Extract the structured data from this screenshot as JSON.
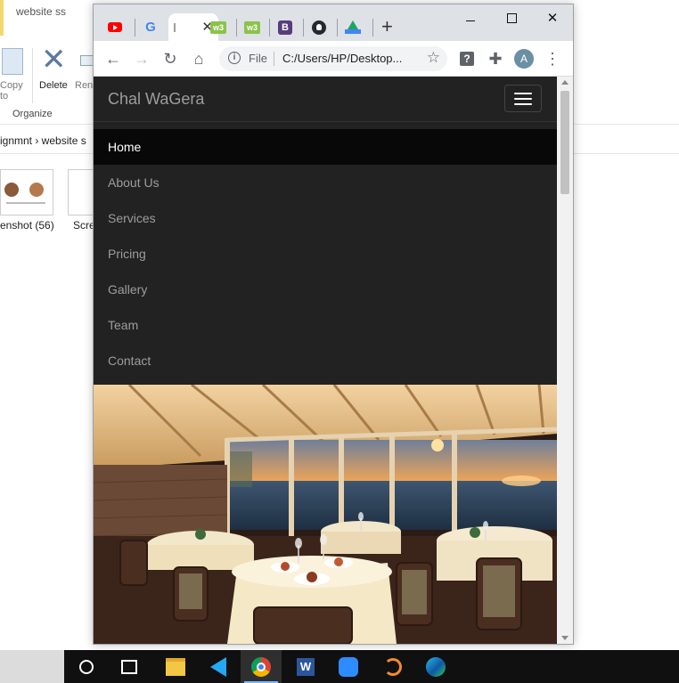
{
  "explorer": {
    "window_title": "website ss",
    "ribbon": {
      "copy_label": "Copy",
      "copy_label2": "to",
      "delete_label": "Delete",
      "rename_label": "Ren",
      "group_label": "Organize"
    },
    "breadcrumb": "ignmnt  ›  website s",
    "files": [
      {
        "label": "enshot (56)"
      },
      {
        "label": "Scre"
      }
    ]
  },
  "browser": {
    "tabs": [
      {
        "icon": "youtube-icon"
      },
      {
        "icon": "google-icon",
        "glyph": "G"
      },
      {
        "icon": "loading-icon",
        "active": true
      },
      {
        "icon": "w3schools-icon",
        "glyph": "w3"
      },
      {
        "icon": "w3schools-icon",
        "glyph": "w3"
      },
      {
        "icon": "bootstrap-icon",
        "glyph": "B"
      },
      {
        "icon": "github-icon"
      },
      {
        "icon": "google-drive-icon"
      }
    ],
    "new_tab_glyph": "+",
    "omnibox": {
      "scheme_label": "File",
      "url": "C:/Users/HP/Desktop..."
    },
    "profile_initial": "A"
  },
  "site": {
    "brand": "Chal WaGera",
    "nav_items": [
      {
        "label": "Home",
        "active": true
      },
      {
        "label": "About Us"
      },
      {
        "label": "Services"
      },
      {
        "label": "Pricing"
      },
      {
        "label": "Gallery"
      },
      {
        "label": "Team"
      },
      {
        "label": "Contact"
      }
    ]
  },
  "taskbar": {
    "word_glyph": "W"
  },
  "colors": {
    "navbar_bg": "#222222",
    "nav_active_bg": "#080808",
    "nav_text": "#9d9d9d",
    "tabstrip_bg": "#dee1e6"
  }
}
